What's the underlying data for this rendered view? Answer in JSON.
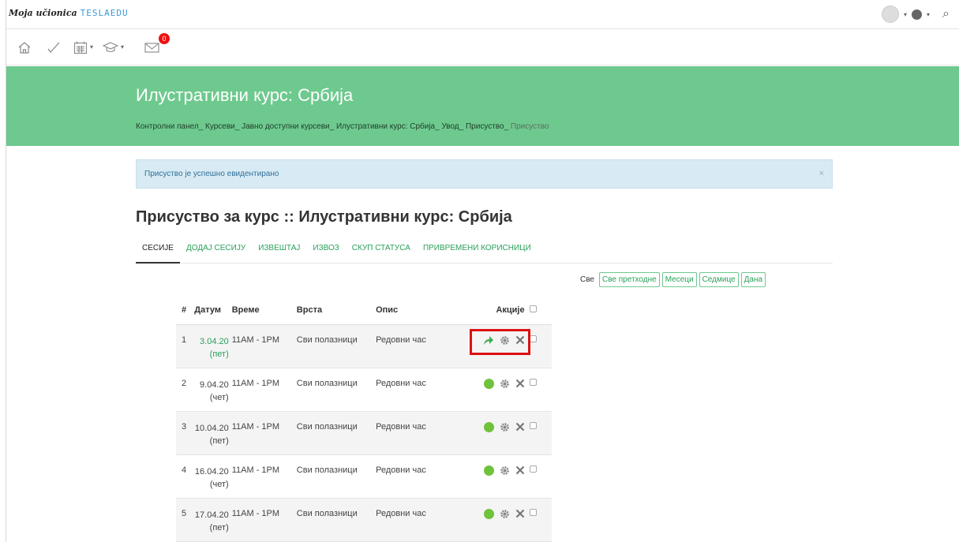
{
  "brand": {
    "script": "Moja učionica",
    "logo": "TESLAEDU"
  },
  "toolbar": {
    "icons": [
      "home-icon",
      "check-icon",
      "calendar-icon",
      "graduation-cap-icon",
      "mail-icon"
    ],
    "mail_count": "0"
  },
  "header": {
    "title": "Илустративни курс: Србија",
    "breadcrumb": [
      "Контролни панел",
      "Курсеви",
      "Јавно доступни курсеви",
      "Илустративни курс: Србија",
      "Увод",
      "Присуство",
      "Присуство"
    ],
    "bg_color": "#6ec98e"
  },
  "alert": {
    "message": "Присуство је успешно евидентирано",
    "close": "×"
  },
  "page": {
    "heading": "Присуство за курс :: Илустративни курс: Србија"
  },
  "tabs": [
    "СЕСИЈЕ",
    "ДОДАЈ СЕСИЈУ",
    "ИЗВЕШТАЈ",
    "ИЗВОЗ",
    "СКУП СТАТУСА",
    "ПРИВРЕМЕНИ КОРИСНИЦИ"
  ],
  "filter": {
    "label": "Све",
    "buttons": [
      "Све претходне",
      "Месеци",
      "Седмице",
      "Дана"
    ]
  },
  "table": {
    "headers": {
      "num": "#",
      "date": "Датум",
      "time": "Време",
      "type": "Врста",
      "desc": "Опис",
      "actions": "Акције"
    },
    "rows": [
      {
        "num": "1",
        "date": "3.04.20",
        "weekday": "(пет)",
        "time": "11AM - 1PM",
        "type": "Сви полазници",
        "desc": "Редовни час",
        "status_icon": "take-attendance-icon"
      },
      {
        "num": "2",
        "date": "9.04.20",
        "weekday": "(чет)",
        "time": "11AM - 1PM",
        "type": "Сви полазници",
        "desc": "Редовни час",
        "status_icon": "status-dot-icon"
      },
      {
        "num": "3",
        "date": "10.04.20",
        "weekday": "(пет)",
        "time": "11AM - 1PM",
        "type": "Сви полазници",
        "desc": "Редовни час",
        "status_icon": "status-dot-icon"
      },
      {
        "num": "4",
        "date": "16.04.20",
        "weekday": "(чет)",
        "time": "11AM - 1PM",
        "type": "Сви полазници",
        "desc": "Редовни час",
        "status_icon": "status-dot-icon"
      },
      {
        "num": "5",
        "date": "17.04.20",
        "weekday": "(пет)",
        "time": "11AM - 1PM",
        "type": "Сви полазници",
        "desc": "Редовни час",
        "status_icon": "status-dot-icon"
      }
    ]
  },
  "colors": {
    "accent_green": "#2aa05a",
    "status_green": "#71c23b",
    "highlight_red": "#dd1111"
  }
}
